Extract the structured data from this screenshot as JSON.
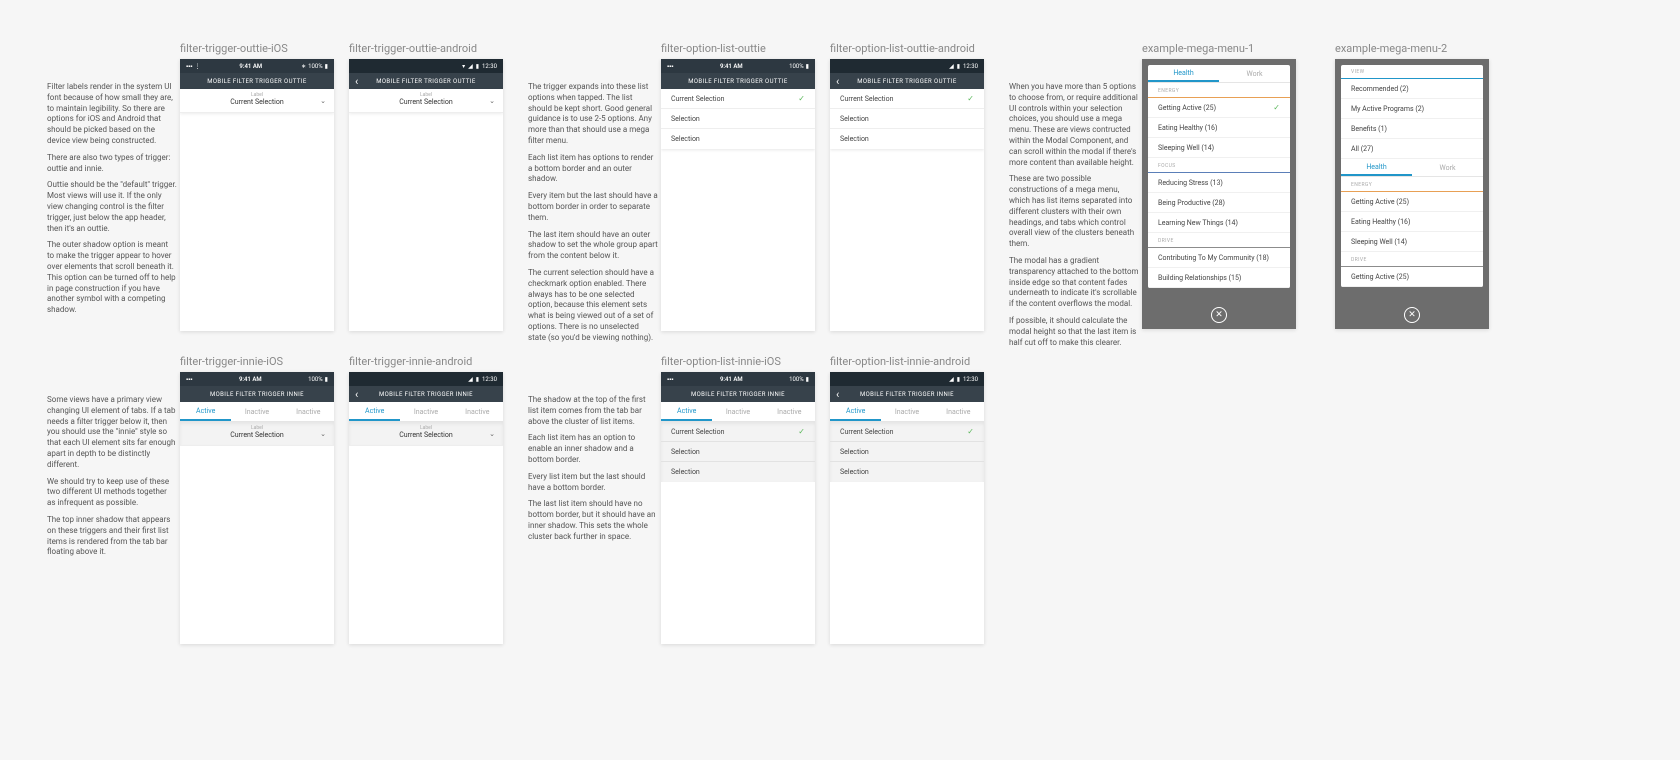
{
  "ios_status": {
    "time": "9:41 AM",
    "batt": "100%"
  },
  "and_status": {
    "time": "12:30"
  },
  "headers": {
    "outtie": "MOBILE FILTER TRIGGER OUTTIE",
    "innie": "MOBILE FILTER TRIGGER INNIE"
  },
  "trigger": {
    "label": "Label",
    "value": "Current Selection"
  },
  "tabs": [
    "Active",
    "Inactive",
    "Inactive"
  ],
  "options": [
    "Current Selection",
    "Selection",
    "Selection"
  ],
  "labels": {
    "f1": "filter-trigger-outtie-iOS",
    "f2": "filter-trigger-outtie-android",
    "f3": "filter-option-list-outtie",
    "f4": "filter-option-list-outtie-android",
    "f5": "filter-trigger-innie-iOS",
    "f6": "filter-trigger-innie-android",
    "f7": "filter-option-list-innie-iOS",
    "f8": "filter-option-list-innie-android",
    "m1": "example-mega-menu-1",
    "m2": "example-mega-menu-2"
  },
  "notes": {
    "n1": [
      "Filter labels render in the system UI font because of how small they are, to maintain legibility. So there are options for iOS and Android that should be picked based on the device view being constructed.",
      "There are also two types of trigger: outtie and innie.",
      "Outtie should be the \"default\" trigger. Most views will use it. If the only view changing control is the filter trigger, just below the app header, then it's an outtie.",
      "The outer shadow option is meant to make the trigger appear to hover over elements that scroll beneath it. This option can be turned off to help in page construction if you have another symbol with a competing shadow."
    ],
    "n2": [
      "The trigger expands into these list options when tapped. The list should be kept short. Good general guidance is to use 2-5 options. Any more than that should use a mega filter menu.",
      "Each list item has options to render a bottom border and an outer shadow.",
      "Every item but the last should have a bottom border in order to separate them.",
      "The last item should have an outer shadow to set the whole group apart from the content below it.",
      "The current selection should have a checkmark option enabled. There always has to be one selected option, because this element sets what is being viewed out of a set of options. There is no unselected state (so you'd be viewing nothing)."
    ],
    "n3": [
      "When you have more than 5 options to choose from, or require additional UI controls within your selection choices, you should use a mega menu. These are views contructed within the Modal Component, and can scroll within the modal if there's more content than available height.",
      "These are two possible constructions of a mega menu, which has list items separated into different clusters with their own headings, and tabs which control overall view of the clusters beneath them.",
      "The modal has a gradient transparency attached to the bottom inside edge so that content fades underneath to indicate it's scrollable if the content overflows the modal.",
      "If possible, it should calculate the modal height so that the last item is half cut off to make this clearer."
    ],
    "n4": [
      "Some views have a primary view changing UI element of tabs. If a tab needs a filter trigger below it, then you should use the \"innie\" style so that each UI element sits far enough apart in depth to be distinctly different.",
      "We should try to keep use of these two different UI methods together as infrequent as possible.",
      "The top inner shadow that appears on these triggers and their first list items is rendered from the tab bar floating above it."
    ],
    "n5": [
      "The shadow at the top of the first list item comes from the tab bar above the cluster of list items.",
      "Each list item has an option to enable an inner shadow and a bottom border.",
      "Every list item but the last should have a bottom border.",
      "The last list item should have no bottom border, but it should have an inner shadow. This sets the whole cluster back further in space."
    ]
  },
  "mega1": {
    "tabs": [
      "Health",
      "Work"
    ],
    "sections": [
      {
        "head": "ENERGY",
        "cls": "energy",
        "items": [
          {
            "t": "Getting Active (25)",
            "c": true
          },
          {
            "t": "Eating Healthy (16)"
          },
          {
            "t": "Sleeping Well (14)"
          }
        ]
      },
      {
        "head": "FOCUS",
        "cls": "focus",
        "items": [
          {
            "t": "Reducing Stress (13)"
          },
          {
            "t": "Being Productive (28)"
          },
          {
            "t": "Learning New Things (14)"
          }
        ]
      },
      {
        "head": "DRIVE",
        "cls": "drive",
        "items": [
          {
            "t": "Contributing To My Community (18)"
          },
          {
            "t": "Building Relationships (15)"
          }
        ]
      }
    ]
  },
  "mega2": {
    "view_head": "VIEW",
    "view_items": [
      "Recommended (2)",
      "My Active Programs (2)",
      "Benefits (1)",
      "All (27)"
    ],
    "tabs": [
      "Health",
      "Work"
    ],
    "sections": [
      {
        "head": "ENERGY",
        "cls": "energy",
        "items": [
          {
            "t": "Getting Active (25)"
          },
          {
            "t": "Eating Healthy (16)"
          },
          {
            "t": "Sleeping Well (14)"
          }
        ]
      },
      {
        "head": "DRIVE",
        "cls": "drive",
        "items": [
          {
            "t": "Getting Active (25)"
          }
        ]
      }
    ]
  }
}
